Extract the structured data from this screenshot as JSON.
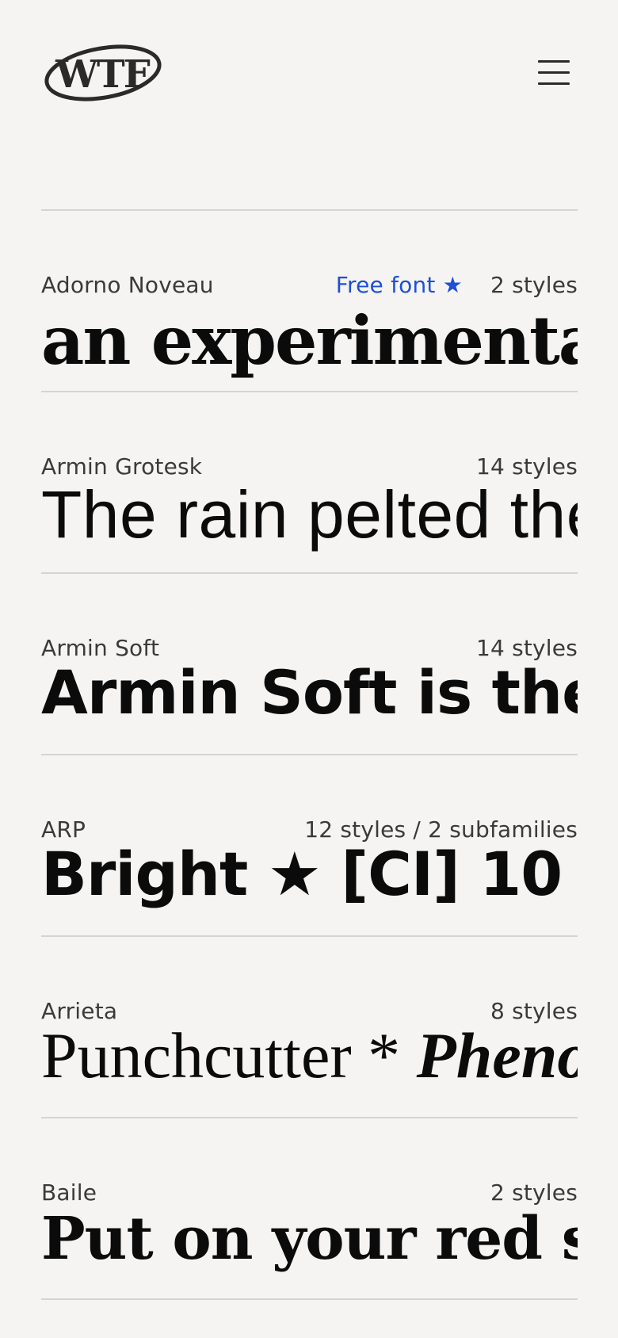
{
  "header": {
    "logo_text": "WTF",
    "menu_icon": "hamburger-menu-icon"
  },
  "fonts": [
    {
      "name": "Adorno Noveau",
      "badge": "Free font ★",
      "styles": "2 styles",
      "sample": "an experimental"
    },
    {
      "name": "Armin Grotesk",
      "styles": "14 styles",
      "sample": "The rain pelted the windows"
    },
    {
      "name": "Armin Soft",
      "styles": "14 styles",
      "sample": "Armin Soft is the softest"
    },
    {
      "name": "ARP",
      "styles": "12 styles / 2 subfamilies",
      "sample": "Bright ★ [CI] 10"
    },
    {
      "name": "Arrieta",
      "styles": "8 styles",
      "sample_roman": "Punchcutter * ",
      "sample_italic": "Phenomenal"
    },
    {
      "name": "Baile",
      "styles": "2 styles",
      "sample": "Put on your red shoes"
    }
  ],
  "colors": {
    "background": "#f5f4f2",
    "text": "#1b1b1b",
    "accent": "#1d4fd8",
    "rule": "#d6d4d0"
  }
}
